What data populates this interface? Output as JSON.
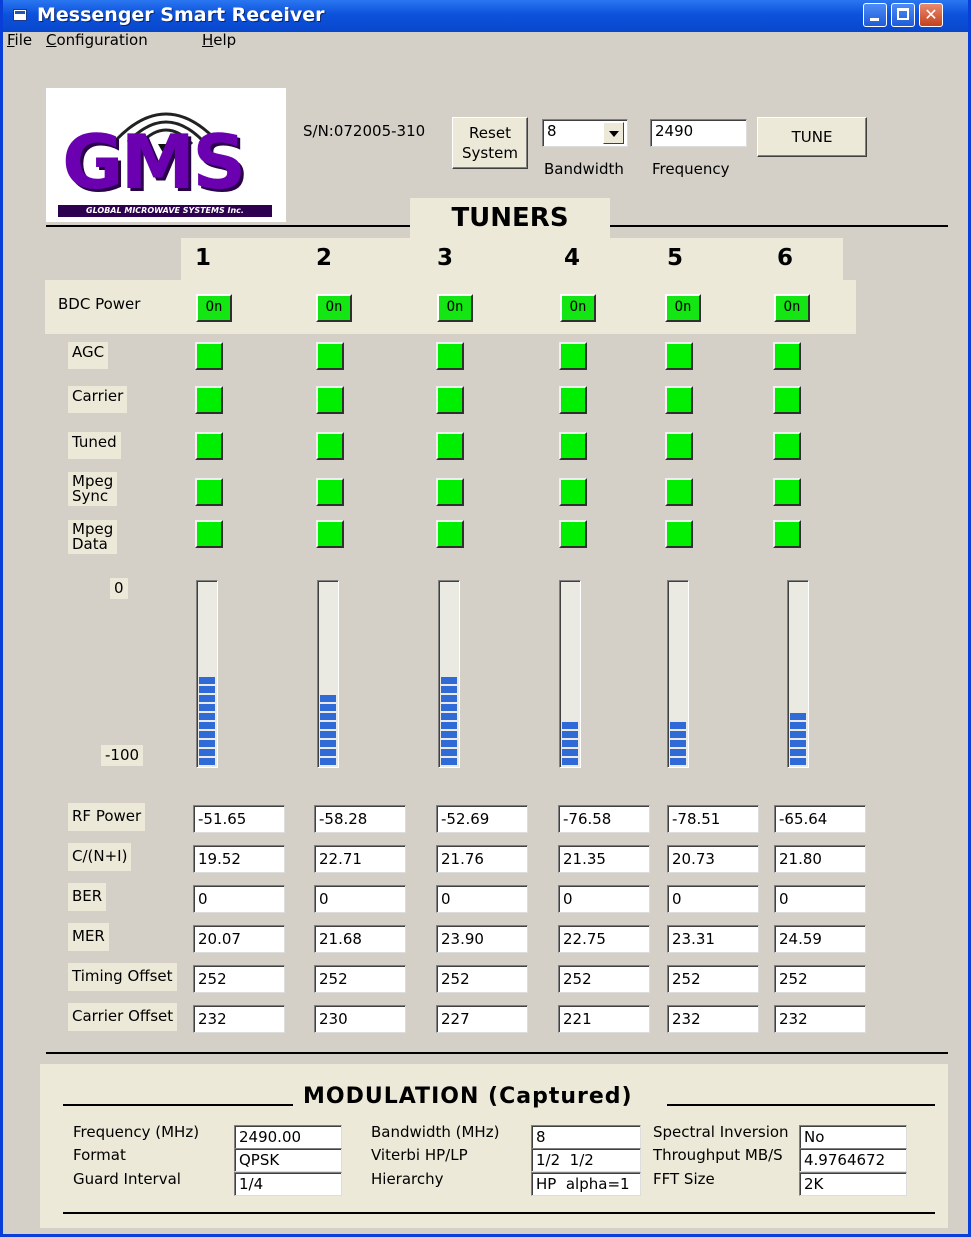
{
  "window": {
    "title": "Messenger Smart Receiver"
  },
  "menu": [
    "File",
    "Configuration",
    "Help"
  ],
  "logo": {
    "text": "GMS",
    "subtitle": "GLOBAL MICROWAVE SYSTEMS Inc."
  },
  "serial": "S/N:072005-310",
  "controls": {
    "reset_label_1": "Reset",
    "reset_label_2": "System",
    "bandwidth_value": "8",
    "bandwidth_label": "Bandwidth",
    "frequency_value": "2490",
    "frequency_label": "Frequency",
    "tune_label": "TUNE"
  },
  "tuners_title": "TUNERS",
  "tuner_numbers": [
    "1",
    "2",
    "3",
    "4",
    "5",
    "6"
  ],
  "bdc_power": {
    "label": "BDC Power",
    "button_label": "On"
  },
  "status_rows": [
    {
      "label": "AGC"
    },
    {
      "label": "Carrier"
    },
    {
      "label": "Tuned"
    },
    {
      "label": "Mpeg\nSync"
    },
    {
      "label": "Mpeg\nData"
    }
  ],
  "led_color": "#00ee00",
  "meter": {
    "top_label": "0",
    "bottom_label": "-100",
    "segment_color": "#2f6ad6",
    "levels_percent": [
      48,
      40,
      48,
      24,
      24,
      32
    ]
  },
  "measurements": [
    {
      "label": "RF Power",
      "values": [
        "-51.65",
        "-58.28",
        "-52.69",
        "-76.58",
        "-78.51",
        "-65.64"
      ]
    },
    {
      "label": "C/(N+I)",
      "values": [
        "19.52",
        "22.71",
        "21.76",
        "21.35",
        "20.73",
        "21.80"
      ]
    },
    {
      "label": "BER",
      "values": [
        "0",
        "0",
        "0",
        "0",
        "0",
        "0"
      ]
    },
    {
      "label": "MER",
      "values": [
        "20.07",
        "21.68",
        "23.90",
        "22.75",
        "23.31",
        "24.59"
      ]
    },
    {
      "label": "Timing Offset",
      "values": [
        "252",
        "252",
        "252",
        "252",
        "252",
        "252"
      ]
    },
    {
      "label": "Carrier Offset",
      "values": [
        "232",
        "230",
        "227",
        "221",
        "232",
        "232"
      ]
    }
  ],
  "modulation": {
    "title": "MODULATION (Captured)",
    "frequency_label": "Frequency (MHz)",
    "frequency_value": "2490.00",
    "format_label": "Format",
    "format_value": "QPSK",
    "guard_label": "Guard Interval",
    "guard_value": "1/4",
    "bandwidth_label": "Bandwidth (MHz)",
    "bandwidth_value": "8",
    "viterbi_label": "Viterbi HP/LP",
    "viterbi_value": "1/2  1/2",
    "hierarchy_label": "Hierarchy",
    "hierarchy_value": "HP  alpha=1",
    "spectral_label": "Spectral Inversion",
    "spectral_value": "No",
    "throughput_label": "Throughput MB/S",
    "throughput_value": "4.9764672",
    "fft_label": "FFT Size",
    "fft_value": "2K"
  }
}
